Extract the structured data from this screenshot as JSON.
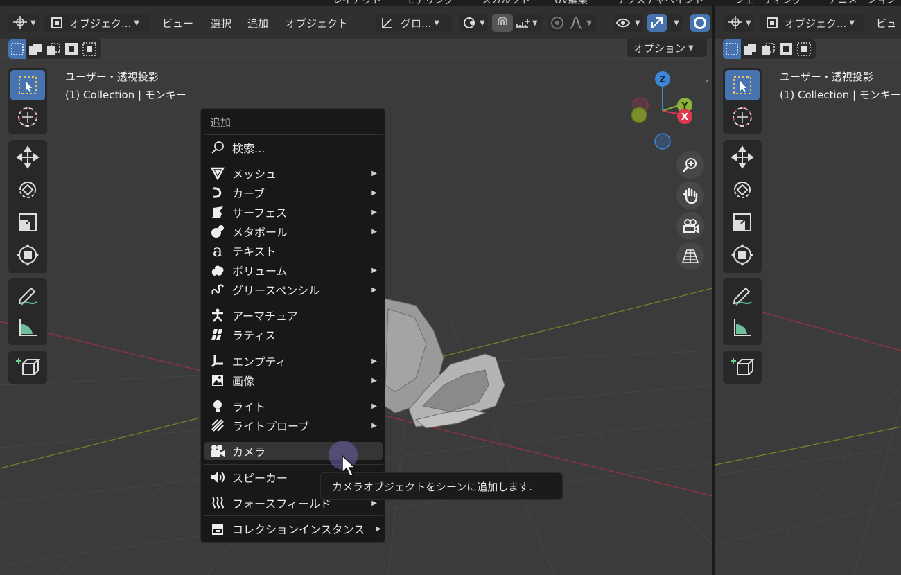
{
  "workspace_tabs": [
    "レイアウト",
    "モデリング",
    "スカルプト",
    "UV編集",
    "テクスチャペイント",
    "シェーディング",
    "アニメーション"
  ],
  "left_header": {
    "mode_label": "オブジェク...",
    "menus": [
      "ビュー",
      "選択",
      "追加",
      "オブジェクト"
    ],
    "orientation_label": "グロ...",
    "options_label": "オプション"
  },
  "right_header": {
    "mode_label": "オブジェク...",
    "menu_partial": "ビュ"
  },
  "viewport_left": {
    "view_name": "ユーザー・透視投影",
    "collection_info": "(1) Collection | モンキー"
  },
  "viewport_right": {
    "view_name": "ユーザー・透視投影",
    "collection_info": "(1) Collection | モンキー"
  },
  "gizmo": {
    "z": "Z",
    "y": "Y",
    "x": "X"
  },
  "add_menu": {
    "title": "追加",
    "search": "検索...",
    "groups": [
      [
        {
          "label": "メッシュ",
          "icon": "mesh-icon",
          "submenu": true
        },
        {
          "label": "カーブ",
          "icon": "curve-icon",
          "submenu": true
        },
        {
          "label": "サーフェス",
          "icon": "surface-icon",
          "submenu": true
        },
        {
          "label": "メタボール",
          "icon": "metaball-icon",
          "submenu": true
        },
        {
          "label": "テキスト",
          "icon": "text-icon",
          "submenu": false
        },
        {
          "label": "ボリューム",
          "icon": "volume-icon",
          "submenu": true
        },
        {
          "label": "グリースペンシル",
          "icon": "grease-pencil-icon",
          "submenu": true
        }
      ],
      [
        {
          "label": "アーマチュア",
          "icon": "armature-icon",
          "submenu": false
        },
        {
          "label": "ラティス",
          "icon": "lattice-icon",
          "submenu": false
        }
      ],
      [
        {
          "label": "エンプティ",
          "icon": "empty-icon",
          "submenu": true
        },
        {
          "label": "画像",
          "icon": "image-icon",
          "submenu": true
        }
      ],
      [
        {
          "label": "ライト",
          "icon": "light-icon",
          "submenu": true
        },
        {
          "label": "ライトプローブ",
          "icon": "light-probe-icon",
          "submenu": true
        }
      ],
      [
        {
          "label": "カメラ",
          "icon": "camera-icon",
          "submenu": false
        }
      ],
      [
        {
          "label": "スピーカー",
          "icon": "speaker-icon",
          "submenu": false
        }
      ],
      [
        {
          "label": "フォースフィールド",
          "icon": "force-field-icon",
          "submenu": true
        }
      ],
      [
        {
          "label": "コレクションインスタンス",
          "icon": "collection-instance-icon",
          "submenu": true
        }
      ]
    ]
  },
  "tooltip": "カメラオブジェクトをシーンに追加します.",
  "colors": {
    "accent": "#4774b0",
    "axis_x": "#e0394f",
    "axis_y": "#8bb33a",
    "axis_z": "#3f86d6",
    "x_grid_line": "#9a3040",
    "y_grid_line": "#6a8a2a"
  }
}
